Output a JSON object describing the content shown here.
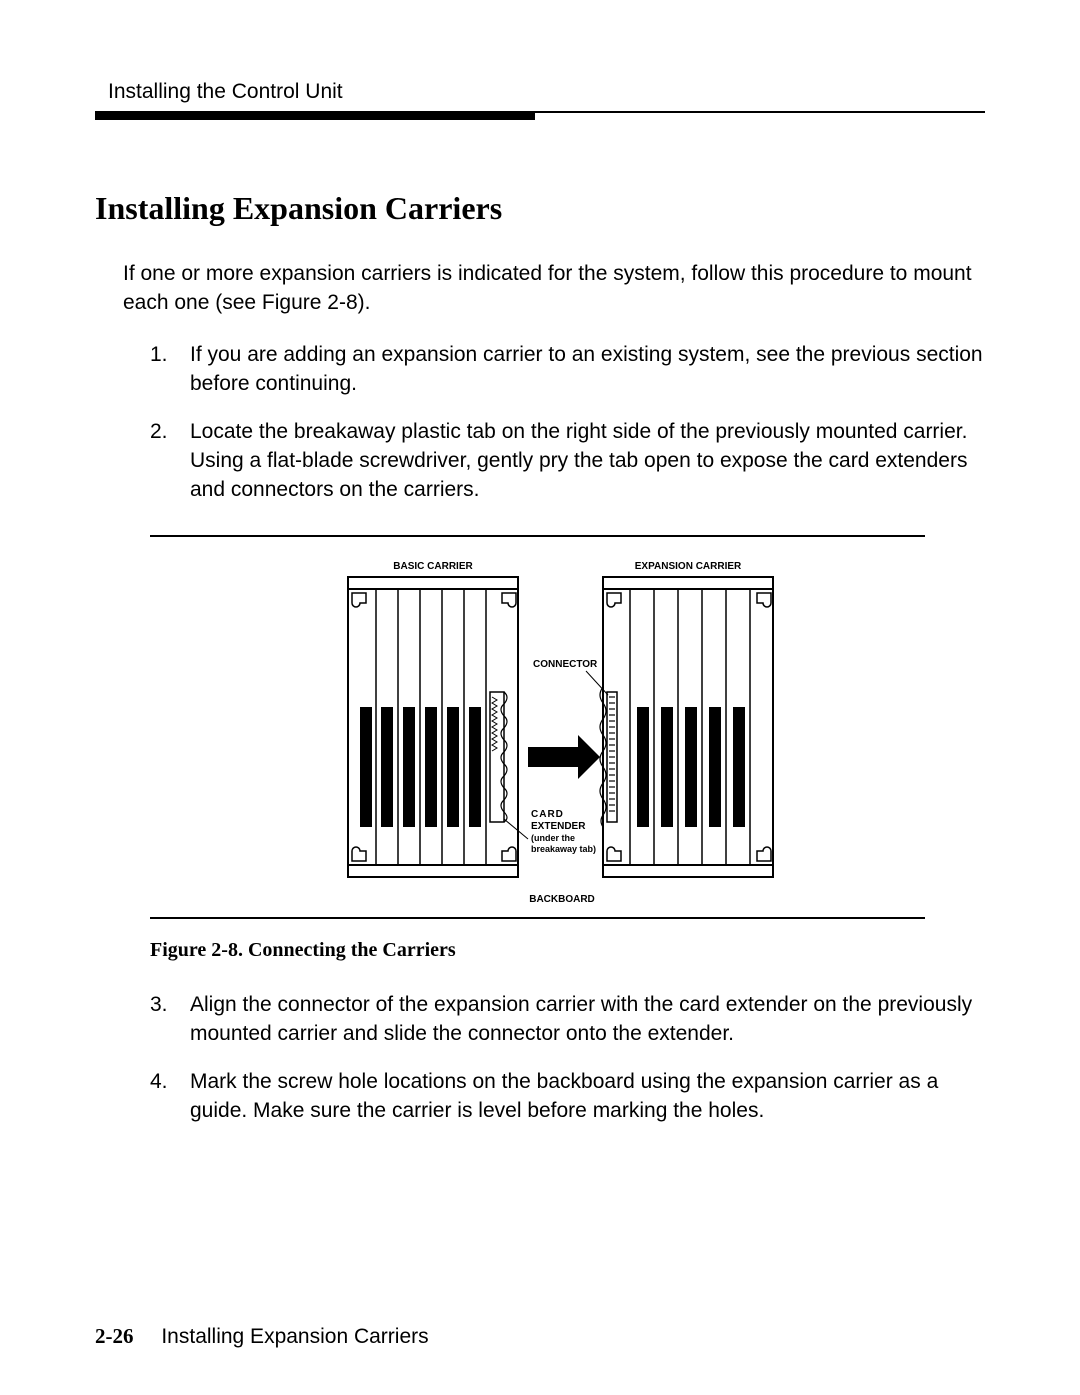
{
  "header": {
    "running_head": "Installing the Control Unit"
  },
  "heading": "Installing Expansion Carriers",
  "intro": "If one or more expansion carriers is indicated for the system, follow this procedure to mount each one (see Figure 2-8).",
  "steps_top": [
    {
      "num": "1.",
      "text": "If you are adding an expansion carrier to an existing system, see the previous section before continuing."
    },
    {
      "num": "2.",
      "text": "Locate the breakaway plastic tab on the right side of the previously mounted carrier. Using a flat-blade screwdriver, gently pry the tab open to expose the card extenders and connectors on the carriers."
    }
  ],
  "figure": {
    "label_basic": "BASIC CARRIER",
    "label_expansion": "EXPANSION CARRIER",
    "label_connector": "CONNECTOR",
    "label_card_extender_1": "CARD",
    "label_card_extender_2": "EXTENDER",
    "label_under": "(under the",
    "label_break": "breakaway tab)",
    "label_backboard": "BACKBOARD",
    "caption": "Figure 2-8.  Connecting the Carriers"
  },
  "steps_bottom": [
    {
      "num": "3.",
      "text": "Align the connector of the expansion carrier with the card extender on the previously mounted carrier and slide the connector onto the extender."
    },
    {
      "num": "4.",
      "text": "Mark the screw hole locations on the backboard using the expansion carrier as a guide. Make sure the carrier is level before marking the holes."
    }
  ],
  "footer": {
    "page": "2-26",
    "title": "Installing Expansion Carriers"
  }
}
